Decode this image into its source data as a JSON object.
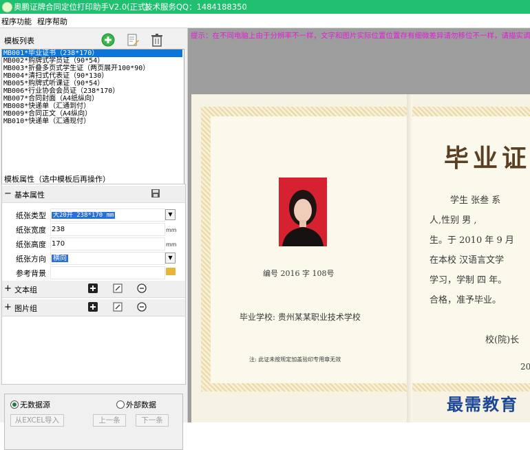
{
  "window": {
    "title": "奥鹏证牌合同定位打印助手V2.0(正式)",
    "qq": "技术服务QQ：1484188350"
  },
  "menu": [
    "程序功能",
    "程序帮助"
  ],
  "left": {
    "list_title": "模板列表",
    "templates": [
      "MB001*毕业证书（238*170）",
      "MB002*购牌式学员证（90*54）",
      "MB003*折叠多页式学生证（两页展开100*90）",
      "MB004*清扫式代表证（90*130）",
      "MB005*购牌式听课证（90*54）",
      "MB006*行业协会会员证（238*170）",
      "MB007*合同封面（A4纸纵向）",
      "MB008*快递单（汇通到付）",
      "MB009*合同正文（A4纵向）",
      "MB010*快递单（汇通现付）"
    ],
    "props_title": "模板属性（选中模板后再操作）",
    "basic_group": "基本属性",
    "props": {
      "paper_type": {
        "label": "纸张类型",
        "value": "大20开 238*170 mm"
      },
      "paper_width": {
        "label": "纸张宽度",
        "value": "238",
        "unit": "mm"
      },
      "paper_height": {
        "label": "纸张高度",
        "value": "170",
        "unit": "mm"
      },
      "paper_direction": {
        "label": "纸张方向",
        "value": "横向"
      },
      "background": {
        "label": "参考背景",
        "value": ""
      }
    },
    "text_group": "文本组",
    "image_group": "图片组",
    "toggle_minus": "−",
    "toggle_plus": "+",
    "radio_none": "无数据源",
    "radio_external": "外部数据",
    "btn_import": "从EXCEL导入",
    "btn_prev": "上一条",
    "btn_next": "下一条"
  },
  "canvas": {
    "hint": "提示：在不同电脑上由于分辨率不一样，文字和图片实际位置位置存有细微差异请勿移位不一样，请描实调整",
    "cert": {
      "title": "毕业证",
      "number": "编号 2016 字 108号",
      "school": "毕业学校: 贵州某某职业技术学校",
      "note": "注: 此证未按规定加盖验印专用章无效",
      "line1": "学生  张叁    系",
      "line2": "人,性别    男     ,",
      "line3": "生。于   2010 年  9 月",
      "line4": "在本校    汉语言文学",
      "line5": "学习，学制    四  年。",
      "line6": "合格，准予毕业。",
      "line7": "校(院)长",
      "line8": "20"
    },
    "watermark": "最需教育"
  }
}
